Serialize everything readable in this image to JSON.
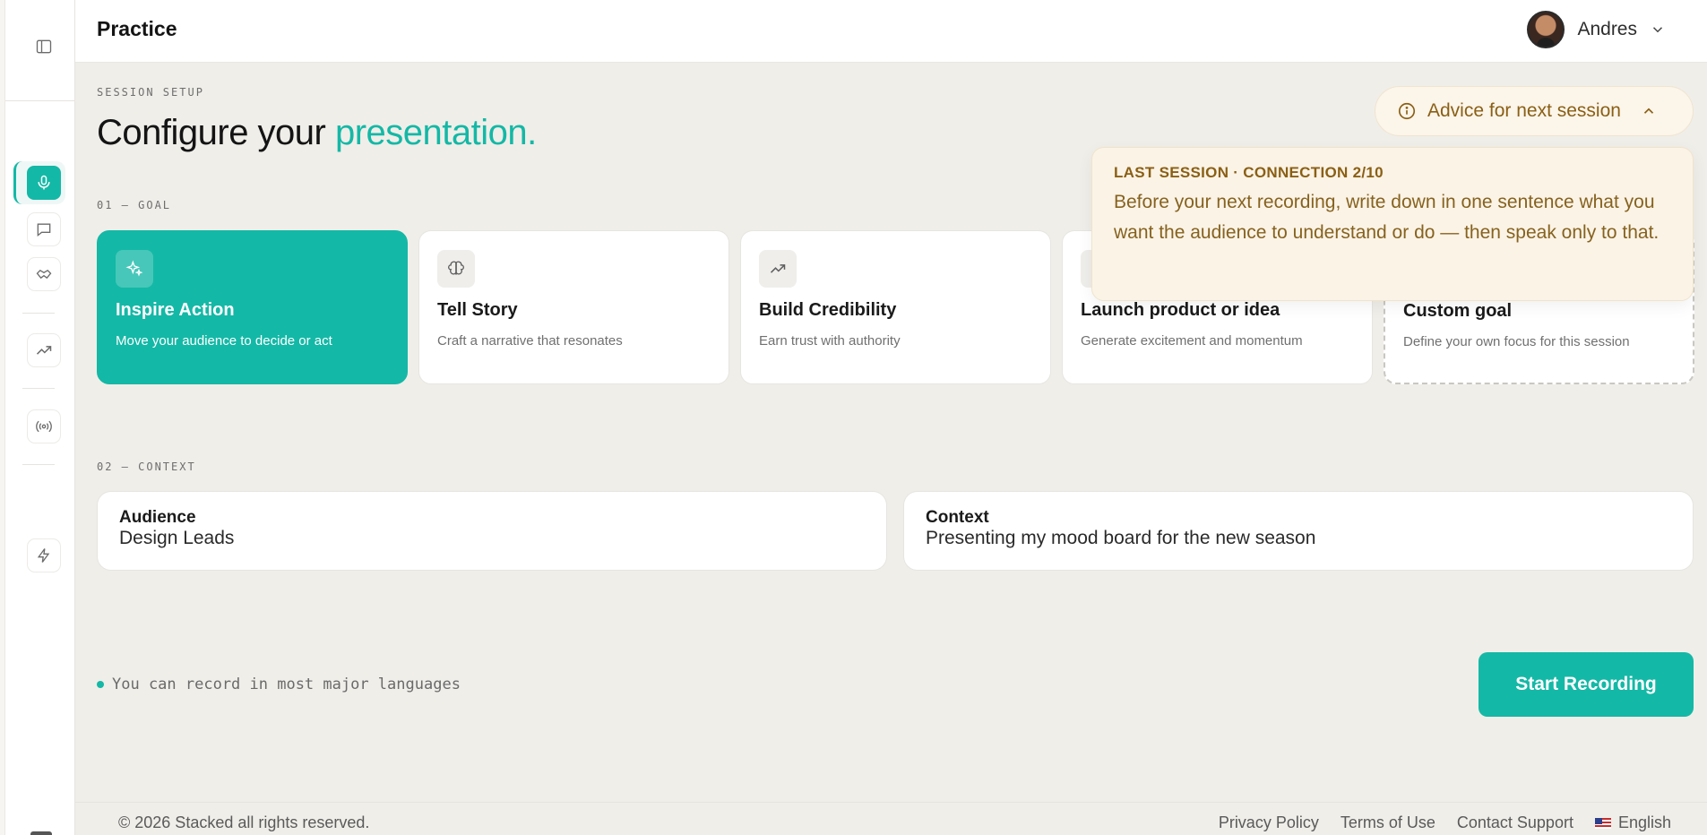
{
  "header": {
    "title": "Practice",
    "user_name": "Andres"
  },
  "setup": {
    "eyebrow": "SESSION SETUP",
    "title_prefix": "Configure your ",
    "title_accent": "presentation."
  },
  "goal": {
    "eyebrow": "01 — GOAL",
    "cards": [
      {
        "icon": "sparkles-icon",
        "title": "Inspire Action",
        "desc": "Move your audience to decide or act",
        "selected": true
      },
      {
        "icon": "brain-icon",
        "title": "Tell Story",
        "desc": "Craft a narrative that resonates"
      },
      {
        "icon": "trending-up-icon",
        "title": "Build Credibility",
        "desc": "Earn trust with authority"
      },
      {
        "icon": "rocket-icon",
        "title": "Launch product or idea",
        "desc": "Generate excitement and momentum"
      },
      {
        "icon": "plus-icon",
        "title": "Custom goal",
        "desc": "Define your own focus for this session"
      }
    ]
  },
  "context": {
    "eyebrow": "02 — CONTEXT",
    "audience_label": "Audience",
    "audience_value": "Design Leads",
    "context_label": "Context",
    "context_value": "Presenting my mood board for the new season"
  },
  "hint": "You can record in most major languages",
  "start_button": "Start Recording",
  "advice": {
    "button_label": "Advice for next session",
    "heading": "LAST SESSION · CONNECTION 2/10",
    "body": "Before your next recording, write down in one sentence what you want the audience to understand or do — then speak only to that."
  },
  "footer": {
    "copyright": "© 2026 Stacked all rights reserved.",
    "links": [
      "Privacy Policy",
      "Terms of Use",
      "Contact Support"
    ],
    "language": "English"
  },
  "colors": {
    "accent": "#14b8a6",
    "advice_text": "#8a5f14",
    "advice_bg": "#fbf3e6"
  }
}
